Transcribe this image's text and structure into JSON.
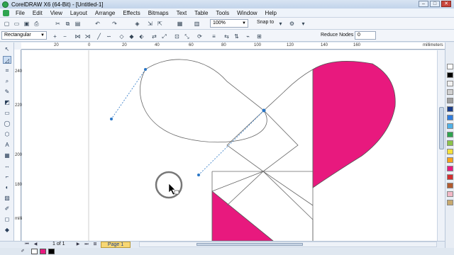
{
  "window": {
    "title": "CorelDRAW X6 (64-Bit) - [Untitled-1]"
  },
  "menu": [
    "File",
    "Edit",
    "View",
    "Layout",
    "Arrange",
    "Effects",
    "Bitmaps",
    "Text",
    "Table",
    "Tools",
    "Window",
    "Help"
  ],
  "toolbar": {
    "zoom": "100%",
    "snap_label": "Snap to"
  },
  "property_bar": {
    "shape_type": "Rectangular",
    "reduce_nodes_label": "Reduce Nodes",
    "reduce_nodes_value": "0"
  },
  "ruler": {
    "unit": "millimeters",
    "h_labels": [
      "20",
      "0",
      "20",
      "40",
      "60",
      "80",
      "100",
      "120",
      "140",
      "160"
    ],
    "v_labels": [
      "240",
      "220",
      "200",
      "180"
    ],
    "v_unit": "millimeters"
  },
  "status": {
    "page_counter": "1 of 1",
    "page_tab": "Page 1"
  },
  "colors": {
    "accent_fill": "#e8197e",
    "palette": [
      "#ffffff",
      "#000000",
      "#f0f0f0",
      "#d0d0d0",
      "#a0a0a0",
      "#1a3d8a",
      "#2f7de0",
      "#4fb1e8",
      "#2ea44f",
      "#8bc34a",
      "#f5e03b",
      "#f7a21b",
      "#e8197e",
      "#d32f2f",
      "#b25a2e",
      "#f2b8c6",
      "#c8a96e"
    ]
  },
  "tools": [
    "pick-tool",
    "shape-tool",
    "crop-tool",
    "zoom-tool",
    "freehand-tool",
    "smart-fill-tool",
    "rectangle-tool",
    "ellipse-tool",
    "polygon-tool",
    "text-tool",
    "table-tool",
    "dimension-tool",
    "connector-tool",
    "blend-tool",
    "transparency-tool",
    "eyedropper-tool",
    "outline-tool",
    "fill-tool",
    "interactive-fill-tool"
  ]
}
